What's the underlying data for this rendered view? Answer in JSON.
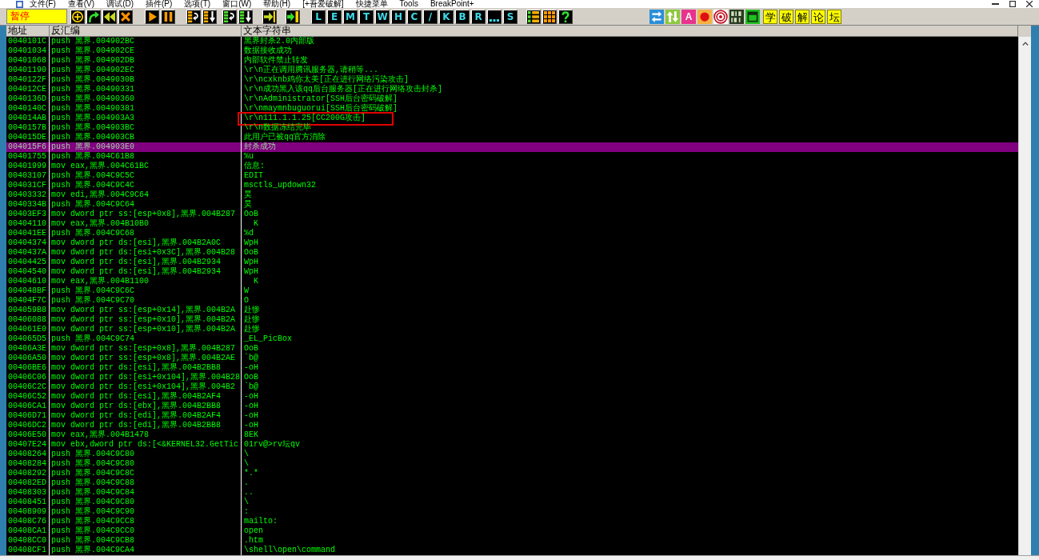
{
  "menu_bar": {
    "items": [
      "文件(F)",
      "查看(V)",
      "调试(D)",
      "插件(P)",
      "选项(T)",
      "窗口(W)",
      "帮助(H)",
      "[+吾爱破解]",
      "快捷菜单",
      "Tools",
      "BreakPoint+"
    ]
  },
  "toolbar": {
    "status": "暂停",
    "view_buttons": [
      {
        "kind": "letter",
        "label": "L"
      },
      {
        "kind": "letter",
        "label": "E"
      },
      {
        "kind": "letter",
        "label": "M"
      },
      {
        "kind": "letter",
        "label": "T"
      },
      {
        "kind": "letter",
        "label": "W"
      },
      {
        "kind": "letter",
        "label": "H"
      },
      {
        "kind": "letter",
        "label": "C"
      },
      {
        "kind": "letter",
        "label": "/"
      },
      {
        "kind": "letter",
        "label": "K"
      },
      {
        "kind": "letter",
        "label": "B"
      },
      {
        "kind": "letter",
        "label": "R"
      },
      {
        "kind": "dots"
      },
      {
        "kind": "letter",
        "label": "S"
      }
    ],
    "tile_label": "A",
    "forum_buttons": [
      "学",
      "破",
      "解",
      "论",
      "坛"
    ]
  },
  "table": {
    "columns": [
      "地址",
      "反汇编",
      "文本字符串"
    ],
    "rows": [
      {
        "address": "0040101C",
        "disassembly": "push 黑界.004902BC",
        "text": "黑界封杀2.0内部版",
        "selected": false,
        "annotated": false
      },
      {
        "address": "00401034",
        "disassembly": "push 黑界.004902CE",
        "text": "数据接收成功",
        "selected": false,
        "annotated": false
      },
      {
        "address": "00401068",
        "disassembly": "push 黑界.004902DB",
        "text": "内部软件禁止转发",
        "selected": false,
        "annotated": false
      },
      {
        "address": "00401190",
        "disassembly": "push 黑界.004902EC",
        "text": "\\r\\n正在调用腾讯服务器,请稍等...",
        "selected": false,
        "annotated": false
      },
      {
        "address": "0040122F",
        "disassembly": "push 黑界.0049030B",
        "text": "\\r\\ncxknb鸡你太美[正在进行网络污染攻击]",
        "selected": false,
        "annotated": false
      },
      {
        "address": "004012CE",
        "disassembly": "push 黑界.00490331",
        "text": "\\r\\n成功黑入该qq后台服务器[正在进行网络攻击封杀]",
        "selected": false,
        "annotated": false
      },
      {
        "address": "0040136D",
        "disassembly": "push 黑界.00490360",
        "text": "\\r\\nAdministrator[SSH后台密码破解]",
        "selected": false,
        "annotated": false
      },
      {
        "address": "0040140C",
        "disassembly": "push 黑界.00490381",
        "text": "\\r\\nmaymnbuguorui[SSH后台密码破解]",
        "selected": false,
        "annotated": false
      },
      {
        "address": "004014AB",
        "disassembly": "push 黑界.004903A3",
        "text": "\\r\\n111.1.1.25[CC200G攻击]",
        "selected": false,
        "annotated": true
      },
      {
        "address": "0040157B",
        "disassembly": "push 黑界.004903BC",
        "text": "\\r\\n数据冻结完毕",
        "selected": false,
        "annotated": false
      },
      {
        "address": "004015DE",
        "disassembly": "push 黑界.004903CB",
        "text": "此用户已被qq官方消除",
        "selected": false,
        "annotated": false
      },
      {
        "address": "004015F6",
        "disassembly": "push 黑界.004903E0",
        "text": "封杀成功",
        "selected": true,
        "annotated": false
      },
      {
        "address": "00401755",
        "disassembly": "push 黑界.004C61B8",
        "text": "%u",
        "selected": false,
        "annotated": false
      },
      {
        "address": "00401999",
        "disassembly": "mov eax,黑界.004C61BC",
        "text": "信息:",
        "selected": false,
        "annotated": false
      },
      {
        "address": "00403107",
        "disassembly": "push 黑界.004C9C5C",
        "text": "EDIT",
        "selected": false,
        "annotated": false
      },
      {
        "address": "004031CF",
        "disassembly": "push 黑界.004C9C4C",
        "text": "msctls_updown32",
        "selected": false,
        "annotated": false
      },
      {
        "address": "00403332",
        "disassembly": "mov edi,黑界.004C9C64",
        "text": "昊",
        "selected": false,
        "annotated": false
      },
      {
        "address": "0040334B",
        "disassembly": "push 黑界.004C9C64",
        "text": "昊",
        "selected": false,
        "annotated": false
      },
      {
        "address": "00403EF3",
        "disassembly": "mov dword ptr ss:[esp+0x8],黑界.004B287",
        "text": "OoB",
        "selected": false,
        "annotated": false
      },
      {
        "address": "00404110",
        "disassembly": "mov eax,黑界.004B10B0",
        "text": "  K",
        "selected": false,
        "annotated": false
      },
      {
        "address": "004041EE",
        "disassembly": "push 黑界.004C9C68",
        "text": "%d",
        "selected": false,
        "annotated": false
      },
      {
        "address": "00404374",
        "disassembly": "mov dword ptr ds:[esi],黑界.004B2A0C",
        "text": "WpH",
        "selected": false,
        "annotated": false
      },
      {
        "address": "0040437A",
        "disassembly": "mov dword ptr ds:[esi+0x3C],黑界.004B28",
        "text": "OoB",
        "selected": false,
        "annotated": false
      },
      {
        "address": "00404425",
        "disassembly": "mov dword ptr ds:[esi],黑界.004B2934",
        "text": "WpH",
        "selected": false,
        "annotated": false
      },
      {
        "address": "00404540",
        "disassembly": "mov dword ptr ds:[esi],黑界.004B2934",
        "text": "WpH",
        "selected": false,
        "annotated": false
      },
      {
        "address": "00404610",
        "disassembly": "mov eax,黑界.004B1100",
        "text": "  K",
        "selected": false,
        "annotated": false
      },
      {
        "address": "004048BF",
        "disassembly": "push 黑界.004C9C6C",
        "text": "W",
        "selected": false,
        "annotated": false
      },
      {
        "address": "00404F7C",
        "disassembly": "push 黑界.004C9C70",
        "text": "O",
        "selected": false,
        "annotated": false
      },
      {
        "address": "004059B8",
        "disassembly": "mov dword ptr ss:[esp+0x14],黑界.004B2A",
        "text": "赴惨",
        "selected": false,
        "annotated": false
      },
      {
        "address": "00406088",
        "disassembly": "mov dword ptr ss:[esp+0x10],黑界.004B2A",
        "text": "赴惨",
        "selected": false,
        "annotated": false
      },
      {
        "address": "004061E0",
        "disassembly": "mov dword ptr ss:[esp+0x10],黑界.004B2A",
        "text": "赴惨",
        "selected": false,
        "annotated": false
      },
      {
        "address": "004065D5",
        "disassembly": "push 黑界.004C9C74",
        "text": "_EL_PicBox",
        "selected": false,
        "annotated": false
      },
      {
        "address": "00406A3E",
        "disassembly": "mov dword ptr ss:[esp+0x8],黑界.004B287",
        "text": "OoB",
        "selected": false,
        "annotated": false
      },
      {
        "address": "00406A50",
        "disassembly": "mov dword ptr ss:[esp+0x8],黑界.004B2AE",
        "text": "`b@",
        "selected": false,
        "annotated": false
      },
      {
        "address": "00406BE6",
        "disassembly": "mov dword ptr ds:[esi],黑界.004B2BB8",
        "text": "-oH",
        "selected": false,
        "annotated": false
      },
      {
        "address": "00406C06",
        "disassembly": "mov dword ptr ds:[esi+0x104],黑界.004B28",
        "text": "OoB",
        "selected": false,
        "annotated": false
      },
      {
        "address": "00406C2C",
        "disassembly": "mov dword ptr ds:[esi+0x104],黑界.004B2",
        "text": "`b@",
        "selected": false,
        "annotated": false
      },
      {
        "address": "00406C52",
        "disassembly": "mov dword ptr ds:[esi],黑界.004B2AF4",
        "text": "-oH",
        "selected": false,
        "annotated": false
      },
      {
        "address": "00406CA1",
        "disassembly": "mov dword ptr ds:[ebx],黑界.004B2BB8",
        "text": "-oH",
        "selected": false,
        "annotated": false
      },
      {
        "address": "00406D71",
        "disassembly": "mov dword ptr ds:[edi],黑界.004B2AF4",
        "text": "-oH",
        "selected": false,
        "annotated": false
      },
      {
        "address": "00406DC2",
        "disassembly": "mov dword ptr ds:[edi],黑界.004B2BB8",
        "text": "-oH",
        "selected": false,
        "annotated": false
      },
      {
        "address": "00406E50",
        "disassembly": "mov eax,黑界.004B1478",
        "text": "8EK",
        "selected": false,
        "annotated": false
      },
      {
        "address": "00407E24",
        "disassembly": "mov ebx,dword ptr ds:[<&KERNEL32.GetTic",
        "text": "01rv@>rv坛qv",
        "selected": false,
        "annotated": false
      },
      {
        "address": "00408264",
        "disassembly": "push 黑界.004C9C80",
        "text": "\\",
        "selected": false,
        "annotated": false
      },
      {
        "address": "00408284",
        "disassembly": "push 黑界.004C9C80",
        "text": "\\",
        "selected": false,
        "annotated": false
      },
      {
        "address": "00408292",
        "disassembly": "push 黑界.004C9C8C",
        "text": "*.*",
        "selected": false,
        "annotated": false
      },
      {
        "address": "004082ED",
        "disassembly": "push 黑界.004C9C88",
        "text": ".",
        "selected": false,
        "annotated": false
      },
      {
        "address": "00408303",
        "disassembly": "push 黑界.004C9C84",
        "text": "..",
        "selected": false,
        "annotated": false
      },
      {
        "address": "00408451",
        "disassembly": "push 黑界.004C9C80",
        "text": "\\",
        "selected": false,
        "annotated": false
      },
      {
        "address": "00408909",
        "disassembly": "push 黑界.004C9C90",
        "text": ":",
        "selected": false,
        "annotated": false
      },
      {
        "address": "00408C76",
        "disassembly": "push 黑界.004C9CC8",
        "text": "mailto:",
        "selected": false,
        "annotated": false
      },
      {
        "address": "00408CA1",
        "disassembly": "push 黑界.004C9CC0",
        "text": "open",
        "selected": false,
        "annotated": false
      },
      {
        "address": "00408CC0",
        "disassembly": "push 黑界.004C9CB8",
        "text": ".htm",
        "selected": false,
        "annotated": false
      },
      {
        "address": "00408CF1",
        "disassembly": "push 黑界.004C9CA4",
        "text": "\\shell\\open\\command",
        "selected": false,
        "annotated": false
      }
    ]
  }
}
